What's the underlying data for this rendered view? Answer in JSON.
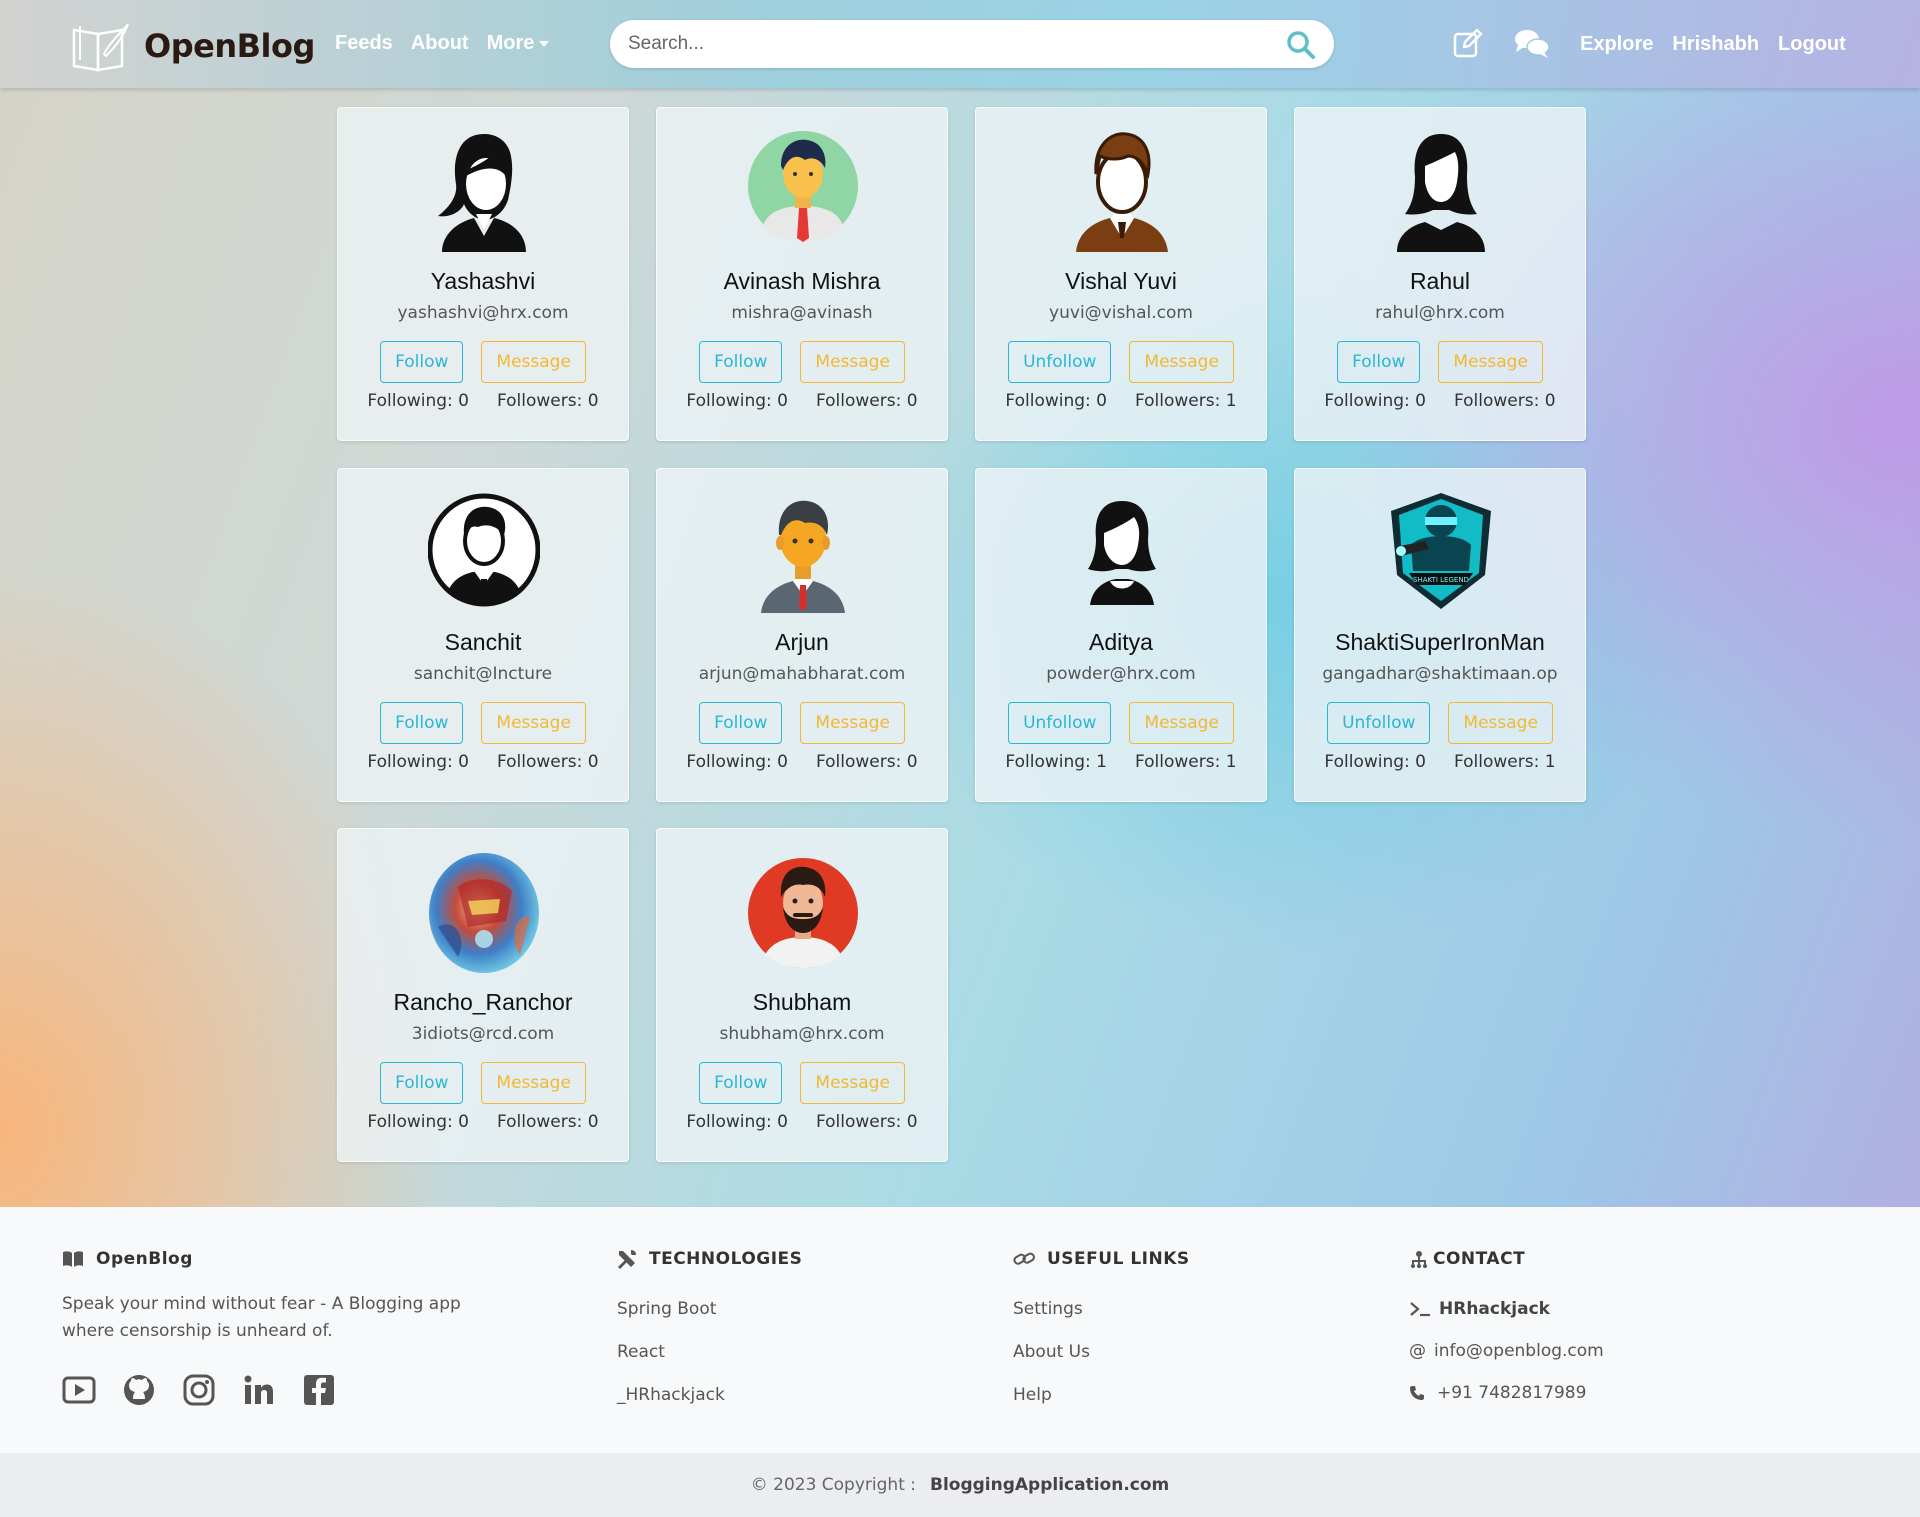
{
  "nav": {
    "brand": "OpenBlog",
    "links": {
      "feeds": "Feeds",
      "about": "About",
      "more": "More"
    },
    "search_placeholder": "Search...",
    "right": {
      "explore": "Explore",
      "user": "Hrishabh",
      "logout": "Logout"
    }
  },
  "users": [
    {
      "name": "Yashashvi",
      "email": "yashashvi@hrx.com",
      "follow_label": "Follow",
      "message_label": "Message",
      "following": "Following: 0",
      "followers": "Followers: 0"
    },
    {
      "name": "Avinash Mishra",
      "email": "mishra@avinash",
      "follow_label": "Follow",
      "message_label": "Message",
      "following": "Following: 0",
      "followers": "Followers: 0"
    },
    {
      "name": "Vishal Yuvi",
      "email": "yuvi@vishal.com",
      "follow_label": "Unfollow",
      "message_label": "Message",
      "following": "Following: 0",
      "followers": "Followers: 1"
    },
    {
      "name": "Rahul",
      "email": "rahul@hrx.com",
      "follow_label": "Follow",
      "message_label": "Message",
      "following": "Following: 0",
      "followers": "Followers: 0"
    },
    {
      "name": "Sanchit",
      "email": "sanchit@Incture",
      "follow_label": "Follow",
      "message_label": "Message",
      "following": "Following: 0",
      "followers": "Followers: 0"
    },
    {
      "name": "Arjun",
      "email": "arjun@mahabharat.com",
      "follow_label": "Follow",
      "message_label": "Message",
      "following": "Following: 0",
      "followers": "Followers: 0"
    },
    {
      "name": "Aditya",
      "email": "powder@hrx.com",
      "follow_label": "Unfollow",
      "message_label": "Message",
      "following": "Following: 1",
      "followers": "Followers: 1"
    },
    {
      "name": "ShaktiSuperIronMan",
      "email": "gangadhar@shaktimaan.op",
      "follow_label": "Unfollow",
      "message_label": "Message",
      "following": "Following: 0",
      "followers": "Followers: 1"
    },
    {
      "name": "Rancho_Ranchor",
      "email": "3idiots@rcd.com",
      "follow_label": "Follow",
      "message_label": "Message",
      "following": "Following: 0",
      "followers": "Followers: 0"
    },
    {
      "name": "Shubham",
      "email": "shubham@hrx.com",
      "follow_label": "Follow",
      "message_label": "Message",
      "following": "Following: 0",
      "followers": "Followers: 0"
    }
  ],
  "footer": {
    "brand": "OpenBlog",
    "tagline": "Speak your mind without fear - A Blogging app where censorship is unheard of.",
    "tech_title": "TECHNOLOGIES",
    "tech": [
      "Spring Boot",
      "React",
      "_HRhackjack"
    ],
    "links_title": "USEFUL LINKS",
    "links": [
      "Settings",
      "About Us",
      "Help"
    ],
    "contact_title": "CONTACT",
    "contact_handle": "HRhackjack",
    "contact_email": "info@openblog.com",
    "contact_phone": "+91 7482817989"
  },
  "copyright": {
    "text": "© 2023 Copyright :",
    "site": "BloggingApplication.com"
  },
  "colors": {
    "follow": "#2bb6d6",
    "message": "#f2b834",
    "search_icon": "#5bc0c8",
    "nav_text": "#ffffff"
  }
}
